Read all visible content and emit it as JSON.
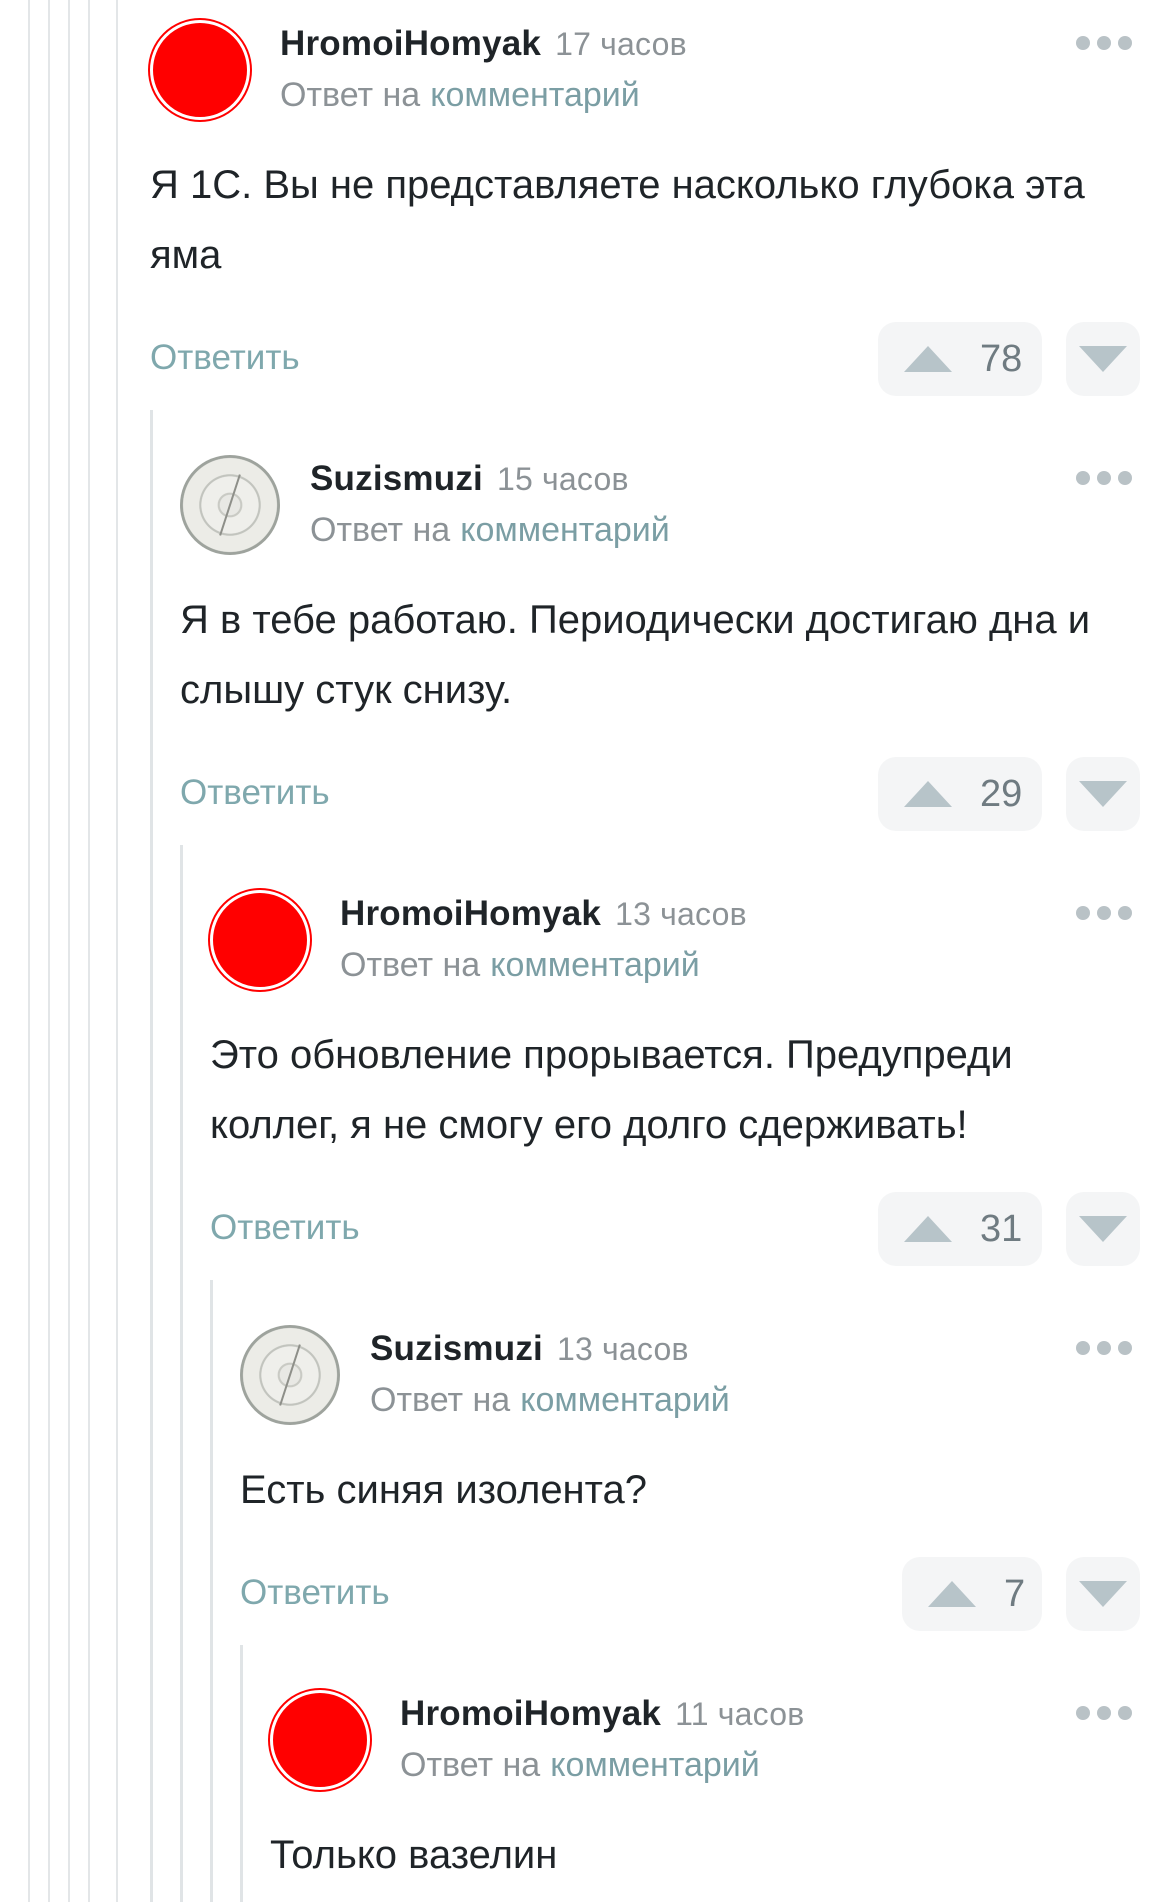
{
  "comments": [
    {
      "username": "HromoiHomyak",
      "time": "17 часов",
      "reply_prefix": "Ответ на",
      "reply_link": "комментарий",
      "text": "Я 1С. Вы не представляете насколько глубока эта яма",
      "reply_label": "Ответить",
      "score": "78",
      "avatar": "red-circle"
    },
    {
      "username": "Suzismuzi",
      "time": "15 часов",
      "reply_prefix": "Ответ на",
      "reply_link": "комментарий",
      "text": "Я в тебе работаю. Периодически достигаю дна и слышу стук снизу.",
      "reply_label": "Ответить",
      "score": "29",
      "avatar": "dial-clock"
    },
    {
      "username": "HromoiHomyak",
      "time": "13 часов",
      "reply_prefix": "Ответ на",
      "reply_link": "комментарий",
      "text": "Это обновление прорывается. Предупреди коллег, я не смогу его долго сдерживать!",
      "reply_label": "Ответить",
      "score": "31",
      "avatar": "red-circle"
    },
    {
      "username": "Suzismuzi",
      "time": "13 часов",
      "reply_prefix": "Ответ на",
      "reply_link": "комментарий",
      "text": "Есть синяя изолента?",
      "reply_label": "Ответить",
      "score": "7",
      "avatar": "dial-clock"
    },
    {
      "username": "HromoiHomyak",
      "time": "11 часов",
      "reply_prefix": "Ответ на",
      "reply_link": "комментарий",
      "text": "Только вазелин",
      "avatar": "red-circle"
    }
  ],
  "icons": {
    "more": "more-dots-icon",
    "upvote": "upvote-arrow-icon",
    "downvote": "downvote-arrow-icon"
  },
  "colors": {
    "link": "#7b9ea4",
    "reply": "#7fa8ad",
    "avatar_red": "#ff0000"
  }
}
